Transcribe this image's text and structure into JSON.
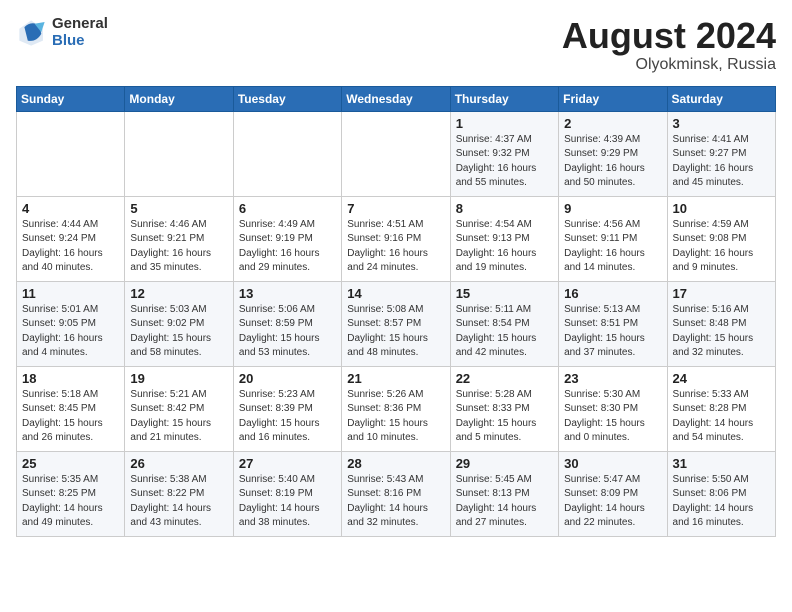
{
  "header": {
    "logo_general": "General",
    "logo_blue": "Blue",
    "title": "August 2024",
    "subtitle": "Olyokminsk, Russia"
  },
  "weekdays": [
    "Sunday",
    "Monday",
    "Tuesday",
    "Wednesday",
    "Thursday",
    "Friday",
    "Saturday"
  ],
  "weeks": [
    [
      {
        "day": "",
        "info": ""
      },
      {
        "day": "",
        "info": ""
      },
      {
        "day": "",
        "info": ""
      },
      {
        "day": "",
        "info": ""
      },
      {
        "day": "1",
        "info": "Sunrise: 4:37 AM\nSunset: 9:32 PM\nDaylight: 16 hours\nand 55 minutes."
      },
      {
        "day": "2",
        "info": "Sunrise: 4:39 AM\nSunset: 9:29 PM\nDaylight: 16 hours\nand 50 minutes."
      },
      {
        "day": "3",
        "info": "Sunrise: 4:41 AM\nSunset: 9:27 PM\nDaylight: 16 hours\nand 45 minutes."
      }
    ],
    [
      {
        "day": "4",
        "info": "Sunrise: 4:44 AM\nSunset: 9:24 PM\nDaylight: 16 hours\nand 40 minutes."
      },
      {
        "day": "5",
        "info": "Sunrise: 4:46 AM\nSunset: 9:21 PM\nDaylight: 16 hours\nand 35 minutes."
      },
      {
        "day": "6",
        "info": "Sunrise: 4:49 AM\nSunset: 9:19 PM\nDaylight: 16 hours\nand 29 minutes."
      },
      {
        "day": "7",
        "info": "Sunrise: 4:51 AM\nSunset: 9:16 PM\nDaylight: 16 hours\nand 24 minutes."
      },
      {
        "day": "8",
        "info": "Sunrise: 4:54 AM\nSunset: 9:13 PM\nDaylight: 16 hours\nand 19 minutes."
      },
      {
        "day": "9",
        "info": "Sunrise: 4:56 AM\nSunset: 9:11 PM\nDaylight: 16 hours\nand 14 minutes."
      },
      {
        "day": "10",
        "info": "Sunrise: 4:59 AM\nSunset: 9:08 PM\nDaylight: 16 hours\nand 9 minutes."
      }
    ],
    [
      {
        "day": "11",
        "info": "Sunrise: 5:01 AM\nSunset: 9:05 PM\nDaylight: 16 hours\nand 4 minutes."
      },
      {
        "day": "12",
        "info": "Sunrise: 5:03 AM\nSunset: 9:02 PM\nDaylight: 15 hours\nand 58 minutes."
      },
      {
        "day": "13",
        "info": "Sunrise: 5:06 AM\nSunset: 8:59 PM\nDaylight: 15 hours\nand 53 minutes."
      },
      {
        "day": "14",
        "info": "Sunrise: 5:08 AM\nSunset: 8:57 PM\nDaylight: 15 hours\nand 48 minutes."
      },
      {
        "day": "15",
        "info": "Sunrise: 5:11 AM\nSunset: 8:54 PM\nDaylight: 15 hours\nand 42 minutes."
      },
      {
        "day": "16",
        "info": "Sunrise: 5:13 AM\nSunset: 8:51 PM\nDaylight: 15 hours\nand 37 minutes."
      },
      {
        "day": "17",
        "info": "Sunrise: 5:16 AM\nSunset: 8:48 PM\nDaylight: 15 hours\nand 32 minutes."
      }
    ],
    [
      {
        "day": "18",
        "info": "Sunrise: 5:18 AM\nSunset: 8:45 PM\nDaylight: 15 hours\nand 26 minutes."
      },
      {
        "day": "19",
        "info": "Sunrise: 5:21 AM\nSunset: 8:42 PM\nDaylight: 15 hours\nand 21 minutes."
      },
      {
        "day": "20",
        "info": "Sunrise: 5:23 AM\nSunset: 8:39 PM\nDaylight: 15 hours\nand 16 minutes."
      },
      {
        "day": "21",
        "info": "Sunrise: 5:26 AM\nSunset: 8:36 PM\nDaylight: 15 hours\nand 10 minutes."
      },
      {
        "day": "22",
        "info": "Sunrise: 5:28 AM\nSunset: 8:33 PM\nDaylight: 15 hours\nand 5 minutes."
      },
      {
        "day": "23",
        "info": "Sunrise: 5:30 AM\nSunset: 8:30 PM\nDaylight: 15 hours\nand 0 minutes."
      },
      {
        "day": "24",
        "info": "Sunrise: 5:33 AM\nSunset: 8:28 PM\nDaylight: 14 hours\nand 54 minutes."
      }
    ],
    [
      {
        "day": "25",
        "info": "Sunrise: 5:35 AM\nSunset: 8:25 PM\nDaylight: 14 hours\nand 49 minutes."
      },
      {
        "day": "26",
        "info": "Sunrise: 5:38 AM\nSunset: 8:22 PM\nDaylight: 14 hours\nand 43 minutes."
      },
      {
        "day": "27",
        "info": "Sunrise: 5:40 AM\nSunset: 8:19 PM\nDaylight: 14 hours\nand 38 minutes."
      },
      {
        "day": "28",
        "info": "Sunrise: 5:43 AM\nSunset: 8:16 PM\nDaylight: 14 hours\nand 32 minutes."
      },
      {
        "day": "29",
        "info": "Sunrise: 5:45 AM\nSunset: 8:13 PM\nDaylight: 14 hours\nand 27 minutes."
      },
      {
        "day": "30",
        "info": "Sunrise: 5:47 AM\nSunset: 8:09 PM\nDaylight: 14 hours\nand 22 minutes."
      },
      {
        "day": "31",
        "info": "Sunrise: 5:50 AM\nSunset: 8:06 PM\nDaylight: 14 hours\nand 16 minutes."
      }
    ]
  ]
}
